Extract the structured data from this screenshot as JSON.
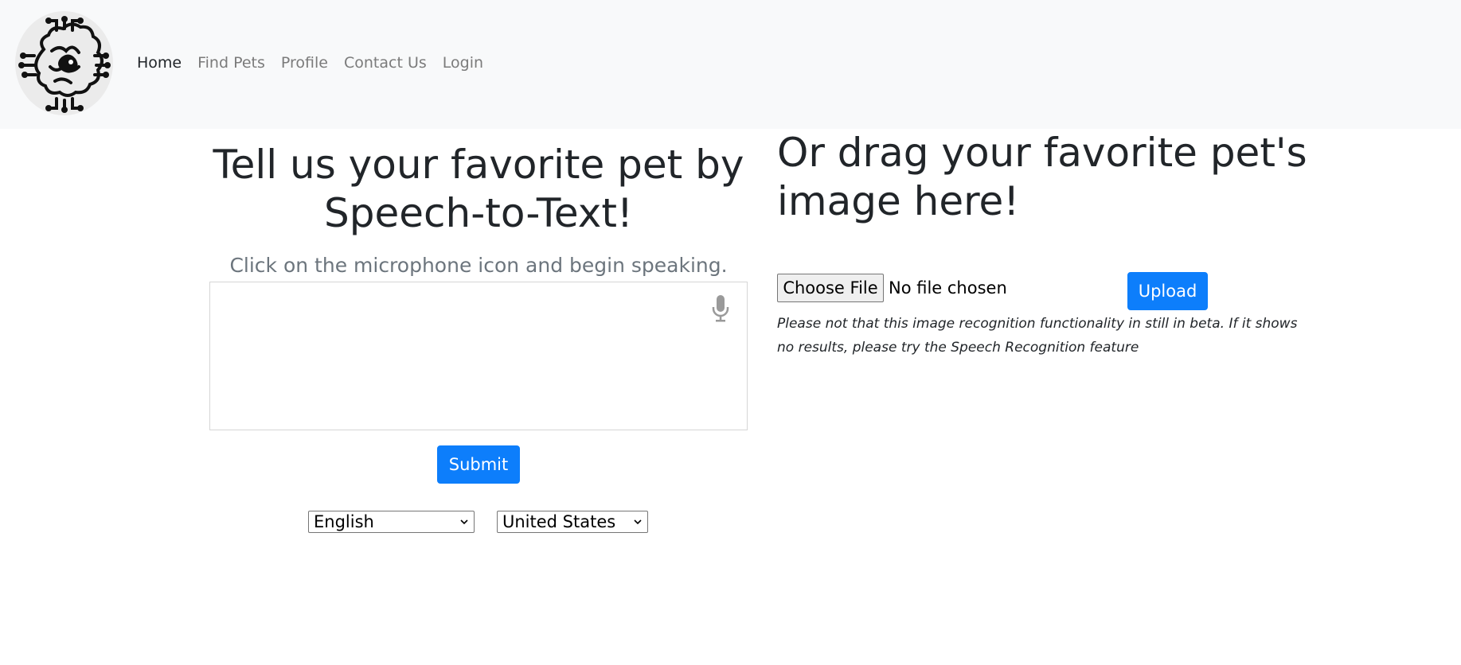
{
  "nav": {
    "items": [
      {
        "label": "Home",
        "active": true
      },
      {
        "label": "Find Pets",
        "active": false
      },
      {
        "label": "Profile",
        "active": false
      },
      {
        "label": "Contact Us",
        "active": false
      },
      {
        "label": "Login",
        "active": false
      }
    ]
  },
  "speech": {
    "heading": "Tell us your favorite pet by Speech-to-Text!",
    "instruction": "Click on the microphone icon and begin speaking.",
    "textarea_value": "",
    "mic_icon": "microphone-icon",
    "submit_label": "Submit",
    "language_selected": "English",
    "country_selected": "United States"
  },
  "image_upload": {
    "heading": "Or drag your favorite pet's image here!",
    "choose_file_label": "Choose File",
    "file_status": "No file chosen",
    "upload_label": "Upload",
    "note": "Please not that this image recognition functionality in still in beta. If it shows no results, please try the Speech Recognition feature"
  },
  "colors": {
    "primary": "#0d7efb",
    "navbar_bg": "#f8f9fa",
    "muted_text": "#6c757d"
  }
}
